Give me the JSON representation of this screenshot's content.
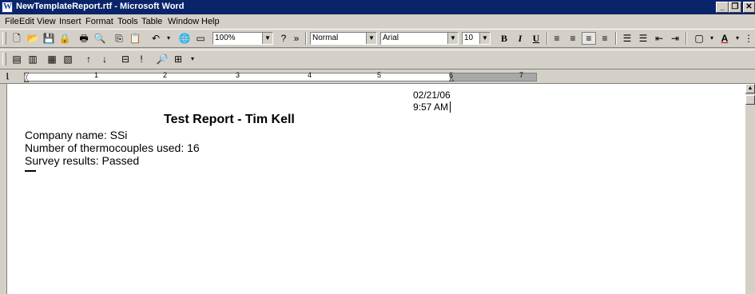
{
  "window": {
    "title": "NewTemplateReport.rtf - Microsoft Word",
    "controls": [
      "minimize-icon",
      "restore-icon",
      "close-icon"
    ]
  },
  "menu": [
    "File",
    "Edit",
    "View",
    "Insert",
    "Format",
    "Tools",
    "Table",
    "Window",
    "Help"
  ],
  "toolbar": {
    "zoom": "100%",
    "style": "Normal",
    "font": "Arial",
    "size": "10",
    "bold": "B",
    "italic": "I",
    "underline": "U",
    "more": "»",
    "font_color_label": "A"
  },
  "ruler": {
    "numbers": [
      "1",
      "2",
      "3",
      "4",
      "5",
      "6",
      "7"
    ]
  },
  "document": {
    "date": "02/21/06",
    "time": "9:57 AM",
    "heading": "Test Report - Tim Kell",
    "lines": [
      "Company name: SSi",
      "Number of thermocouples used: 16",
      "Survey results: Passed"
    ]
  }
}
